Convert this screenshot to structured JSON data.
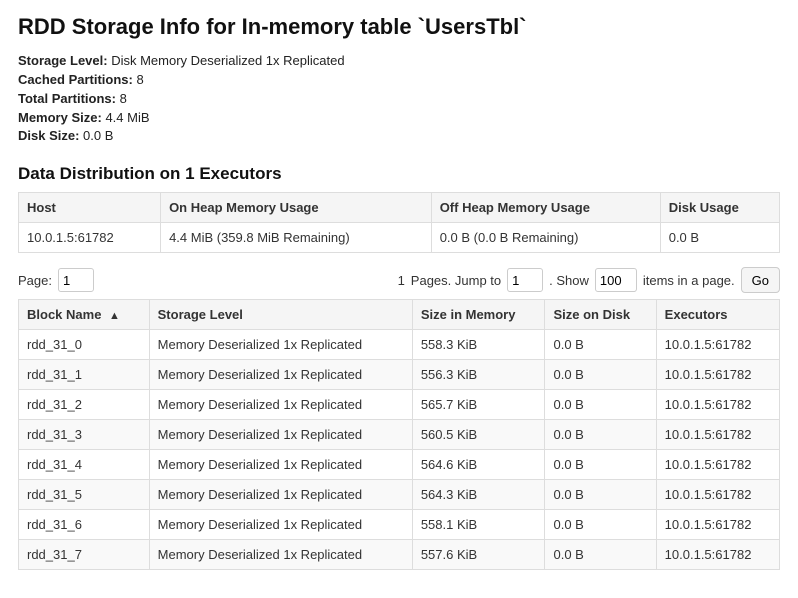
{
  "title": "RDD Storage Info for In-memory table `UsersTbl`",
  "summary": {
    "labels": {
      "storage_level": "Storage Level:",
      "cached_partitions": "Cached Partitions:",
      "total_partitions": "Total Partitions:",
      "memory_size": "Memory Size:",
      "disk_size": "Disk Size:"
    },
    "storage_level": "Disk Memory Deserialized 1x Replicated",
    "cached_partitions": "8",
    "total_partitions": "8",
    "memory_size": "4.4 MiB",
    "disk_size": "0.0 B"
  },
  "distribution": {
    "heading": "Data Distribution on 1 Executors",
    "columns": [
      "Host",
      "On Heap Memory Usage",
      "Off Heap Memory Usage",
      "Disk Usage"
    ],
    "rows": [
      {
        "host": "10.0.1.5:61782",
        "on_heap": "4.4 MiB (359.8 MiB Remaining)",
        "off_heap": "0.0 B (0.0 B Remaining)",
        "disk": "0.0 B"
      }
    ]
  },
  "pager": {
    "page_label": "Page:",
    "page_value": "1",
    "pages_text_prefix": "1",
    "pages_text_suffix": "Pages. Jump to",
    "jump_value": "1",
    "show_label_before": ". Show",
    "show_value": "100",
    "show_label_after": "items in a page.",
    "go_label": "Go"
  },
  "blocks": {
    "columns": [
      "Block Name",
      "Storage Level",
      "Size in Memory",
      "Size on Disk",
      "Executors"
    ],
    "sort_indicator": "▲",
    "rows": [
      {
        "name": "rdd_31_0",
        "storage": "Memory Deserialized 1x Replicated",
        "mem": "558.3 KiB",
        "disk": "0.0 B",
        "exec": "10.0.1.5:61782"
      },
      {
        "name": "rdd_31_1",
        "storage": "Memory Deserialized 1x Replicated",
        "mem": "556.3 KiB",
        "disk": "0.0 B",
        "exec": "10.0.1.5:61782"
      },
      {
        "name": "rdd_31_2",
        "storage": "Memory Deserialized 1x Replicated",
        "mem": "565.7 KiB",
        "disk": "0.0 B",
        "exec": "10.0.1.5:61782"
      },
      {
        "name": "rdd_31_3",
        "storage": "Memory Deserialized 1x Replicated",
        "mem": "560.5 KiB",
        "disk": "0.0 B",
        "exec": "10.0.1.5:61782"
      },
      {
        "name": "rdd_31_4",
        "storage": "Memory Deserialized 1x Replicated",
        "mem": "564.6 KiB",
        "disk": "0.0 B",
        "exec": "10.0.1.5:61782"
      },
      {
        "name": "rdd_31_5",
        "storage": "Memory Deserialized 1x Replicated",
        "mem": "564.3 KiB",
        "disk": "0.0 B",
        "exec": "10.0.1.5:61782"
      },
      {
        "name": "rdd_31_6",
        "storage": "Memory Deserialized 1x Replicated",
        "mem": "558.1 KiB",
        "disk": "0.0 B",
        "exec": "10.0.1.5:61782"
      },
      {
        "name": "rdd_31_7",
        "storage": "Memory Deserialized 1x Replicated",
        "mem": "557.6 KiB",
        "disk": "0.0 B",
        "exec": "10.0.1.5:61782"
      }
    ]
  }
}
